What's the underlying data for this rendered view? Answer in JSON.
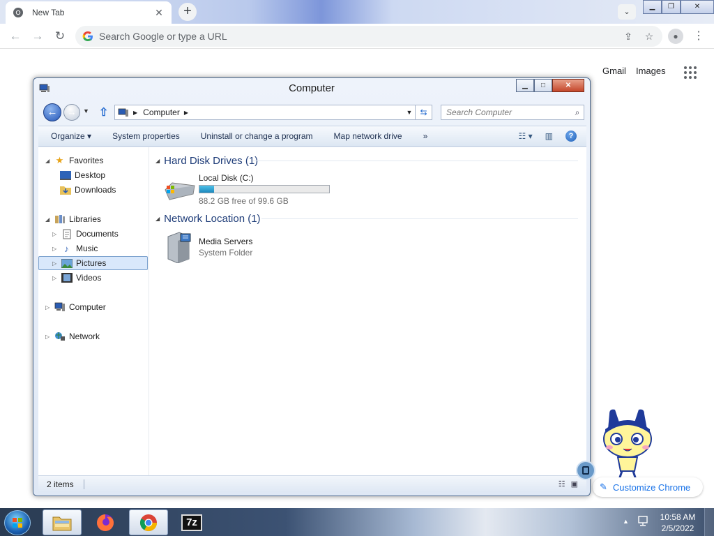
{
  "browser": {
    "tab_title": "New Tab",
    "omnibox_placeholder": "Search Google or type a URL",
    "ntp_links": [
      "Gmail",
      "Images"
    ],
    "customize_label": "Customize Chrome"
  },
  "explorer": {
    "title": "Computer",
    "address_path": "Computer",
    "search_placeholder": "Search Computer",
    "commands": {
      "organize": "Organize ▾",
      "system_properties": "System properties",
      "uninstall": "Uninstall or change a program",
      "map_drive": "Map network drive",
      "more": "»"
    },
    "nav": {
      "favorites": "Favorites",
      "desktop": "Desktop",
      "downloads": "Downloads",
      "libraries": "Libraries",
      "documents": "Documents",
      "music": "Music",
      "pictures": "Pictures",
      "videos": "Videos",
      "computer": "Computer",
      "network": "Network"
    },
    "groups": {
      "hard_disk": "Hard Disk Drives (1)",
      "network_location": "Network Location (1)"
    },
    "drive": {
      "name": "Local Disk (C:)",
      "free_text": "88.2 GB free of 99.6 GB",
      "used_fraction": 0.114
    },
    "media": {
      "name": "Media Servers",
      "subtitle": "System Folder"
    },
    "status": "2 items"
  },
  "taskbar": {
    "time": "10:58 AM",
    "date": "2/5/2022",
    "sevenzip_label": "7z"
  },
  "colors": {
    "accent": "#1a73e8",
    "explorer_heading": "#1e3c78",
    "selection": "#d9e8fb"
  }
}
